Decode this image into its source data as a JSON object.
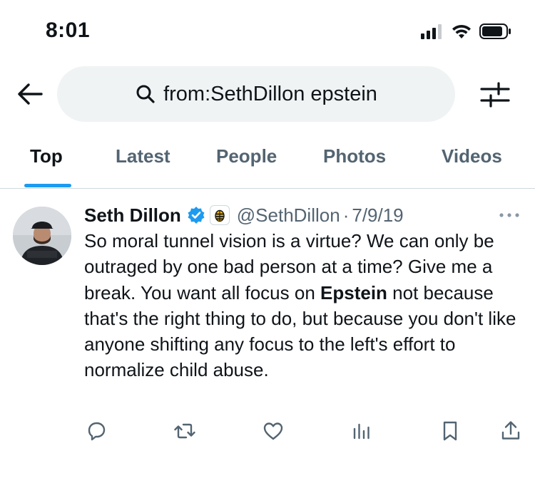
{
  "status_bar": {
    "time": "8:01",
    "icons": [
      "cellular-signal-icon",
      "wifi-icon",
      "battery-icon"
    ]
  },
  "header": {
    "back_icon": "arrow-left-icon",
    "search_icon": "search-icon",
    "search_query": "from:SethDillon epstein",
    "filter_icon": "sliders-icon"
  },
  "tabs": [
    {
      "label": "Top",
      "active": true
    },
    {
      "label": "Latest",
      "active": false
    },
    {
      "label": "People",
      "active": false
    },
    {
      "label": "Photos",
      "active": false
    },
    {
      "label": "Videos",
      "active": false
    }
  ],
  "colors": {
    "accent": "#1d9bf0",
    "text_primary": "#0f1419",
    "text_secondary": "#536471",
    "search_bg": "#eff3f4",
    "divider": "#cfd9de"
  },
  "tweet": {
    "author_name": "Seth Dillon",
    "verified": true,
    "affiliate_badge": "bee-icon",
    "handle": "@SethDillon",
    "separator": "·",
    "date": "7/9/19",
    "text_before_highlight": "So moral tunnel vision is a virtue? We can only be outraged by one bad person at a time? Give me a break. You want all focus on ",
    "highlight": "Epstein",
    "text_after_highlight": " not because that's the right thing to do, but because you don't like anyone shifting any focus to the left's effort to normalize child abuse.",
    "actions": [
      "reply-icon",
      "retweet-icon",
      "like-icon",
      "views-icon",
      "bookmark-icon",
      "share-icon"
    ]
  }
}
